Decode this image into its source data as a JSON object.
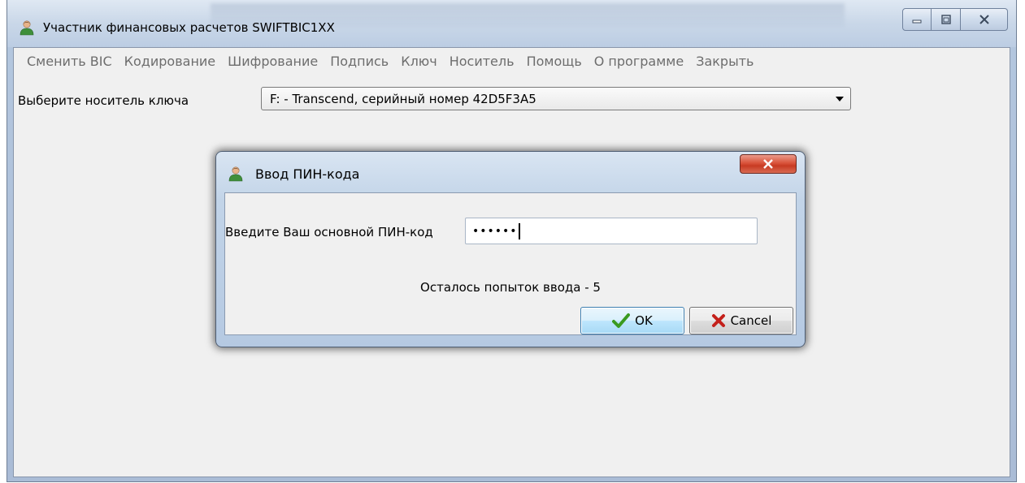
{
  "window": {
    "title": "Участник финансовых расчетов SWIFTBIC1XX",
    "icon": "user-icon",
    "controls": [
      "minimize-icon",
      "maximize-icon",
      "close-icon"
    ]
  },
  "menu": {
    "items": [
      "Сменить BIC",
      "Кодирование",
      "Шифрование",
      "Подпись",
      "Ключ",
      "Носитель",
      "Помощь",
      "О программе",
      "Закрыть"
    ]
  },
  "carrier": {
    "label": "Выберите носитель ключа",
    "selected": "F: - Transcend, серийный номер 42D5F3A5"
  },
  "pin_dialog": {
    "title": "Ввод ПИН-кода",
    "icon": "user-icon",
    "pin_label": "Введите Ваш основной ПИН-код",
    "pin_value": "••••••",
    "attempts_text": "Осталось попыток ввода - 5",
    "ok_label": "OK",
    "cancel_label": "Cancel"
  },
  "colors": {
    "frame": "#b9cbe2",
    "client_bg": "#f0f0f0",
    "menu_text": "#6d6d6d",
    "close_button": "#d9533b",
    "ok_check": "#3a9a1f",
    "cancel_x": "#c4201a"
  }
}
